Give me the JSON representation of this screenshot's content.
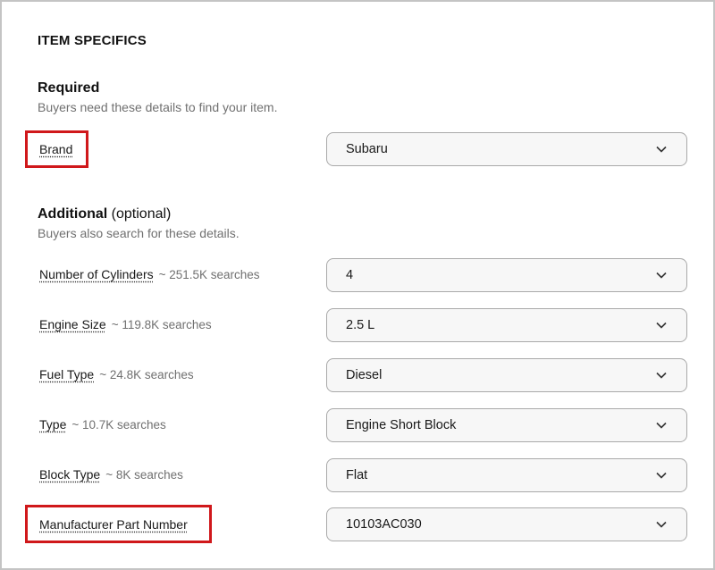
{
  "section": {
    "title": "ITEM SPECIFICS"
  },
  "required": {
    "heading": "Required",
    "subtitle": "Buyers need these details to find your item.",
    "fields": [
      {
        "label": "Brand",
        "searches": "",
        "value": "Subaru",
        "highlighted": true
      }
    ]
  },
  "additional": {
    "heading": "Additional",
    "heading_suffix": "(optional)",
    "subtitle": "Buyers also search for these details.",
    "fields": [
      {
        "label": "Number of Cylinders",
        "searches": "~ 251.5K searches",
        "value": "4"
      },
      {
        "label": "Engine Size",
        "searches": "~ 119.8K searches",
        "value": "2.5 L"
      },
      {
        "label": "Fuel Type",
        "searches": "~ 24.8K searches",
        "value": "Diesel"
      },
      {
        "label": "Type",
        "searches": "~ 10.7K searches",
        "value": "Engine Short Block"
      },
      {
        "label": "Block Type",
        "searches": "~ 8K searches",
        "value": "Flat"
      },
      {
        "label": "Manufacturer Part Number",
        "searches": "",
        "value": "10103AC030",
        "highlighted": true
      }
    ]
  },
  "icons": {
    "dropdown": "chevron-down-icon"
  },
  "colors": {
    "highlight_border": "#d0181b",
    "select_background": "#f7f7f7",
    "secondary_text": "#707070"
  }
}
